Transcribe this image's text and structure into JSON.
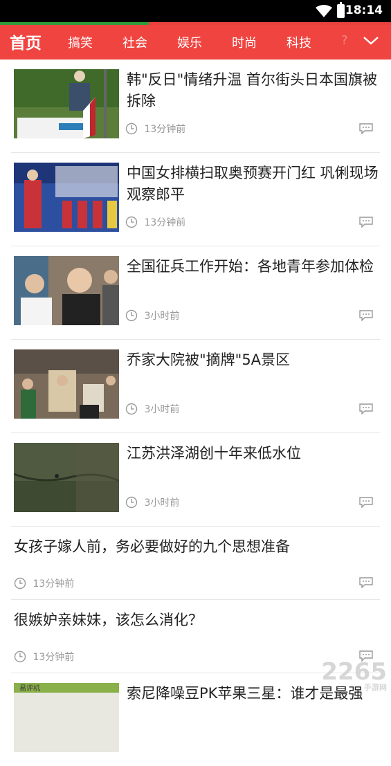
{
  "status_bar": {
    "time": "18:14"
  },
  "load_progress": 0.38,
  "nav": {
    "home": "首页",
    "tabs": [
      "搞笑",
      "社会",
      "娱乐",
      "时尚",
      "科技"
    ],
    "faded": "?"
  },
  "news": [
    {
      "title": "韩\"反日\"情绪升温 首尔街头日本国旗被拆除",
      "time": "13分钟前",
      "thumb": "street-flag-photo"
    },
    {
      "title": "中国女排横扫取奥预赛开门红 巩俐现场观察郎平",
      "time": "13分钟前",
      "thumb": "volleyball-photo"
    },
    {
      "title": "全国征兵工作开始：各地青年参加体检",
      "time": "3小时前",
      "thumb": "medical-check-photo"
    },
    {
      "title": "乔家大院被\"摘牌\"5A景区",
      "time": "3小时前",
      "thumb": "courtyard-crowd-photo"
    },
    {
      "title": "江苏洪泽湖创十年来低水位",
      "time": "3小时前",
      "thumb": "lake-photo"
    },
    {
      "title": "女孩子嫁人前，务必要做好的九个思想准备",
      "time": "13分钟前"
    },
    {
      "title": "很嫉妒亲妹妹，该怎么消化？",
      "time": "13分钟前"
    },
    {
      "title": "索尼降噪豆PK苹果三星：谁才是最强",
      "thumb": "earbuds-photo"
    }
  ],
  "watermark": {
    "brand": "2265",
    "sub": "手游网"
  },
  "colors": {
    "nav": "#ef4440",
    "progress": "#2e9c3a"
  }
}
